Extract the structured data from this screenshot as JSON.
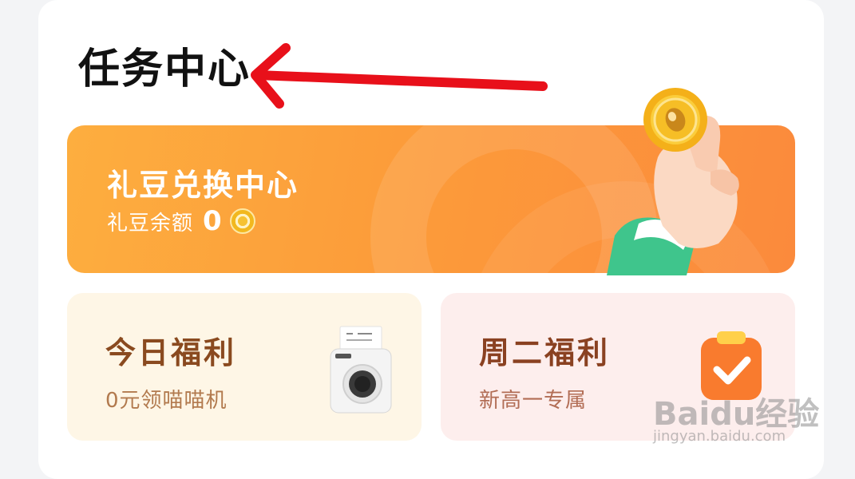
{
  "page": {
    "title": "任务中心"
  },
  "exchange": {
    "title": "礼豆兑换中心",
    "balance_label": "礼豆余额",
    "balance_value": "0"
  },
  "cards": [
    {
      "title": "今日福利",
      "subtitle": "0元领喵喵机"
    },
    {
      "title": "周二福利",
      "subtitle": "新高一专属"
    }
  ],
  "watermark": {
    "logo": "Baidu经验",
    "url": "jingyan.baidu.com"
  },
  "colors": {
    "banner_orange": "#fc9c3a",
    "annotation_arrow": "#e8101a",
    "card_today_bg": "#fef6e6",
    "card_tuesday_bg": "#fdeeed"
  },
  "icons": {
    "bean": "bean-coin-icon",
    "hand": "hand-holding-coin-icon",
    "printer": "printer-icon",
    "clipboard": "clipboard-check-icon",
    "arrow": "annotation-arrow-icon"
  }
}
